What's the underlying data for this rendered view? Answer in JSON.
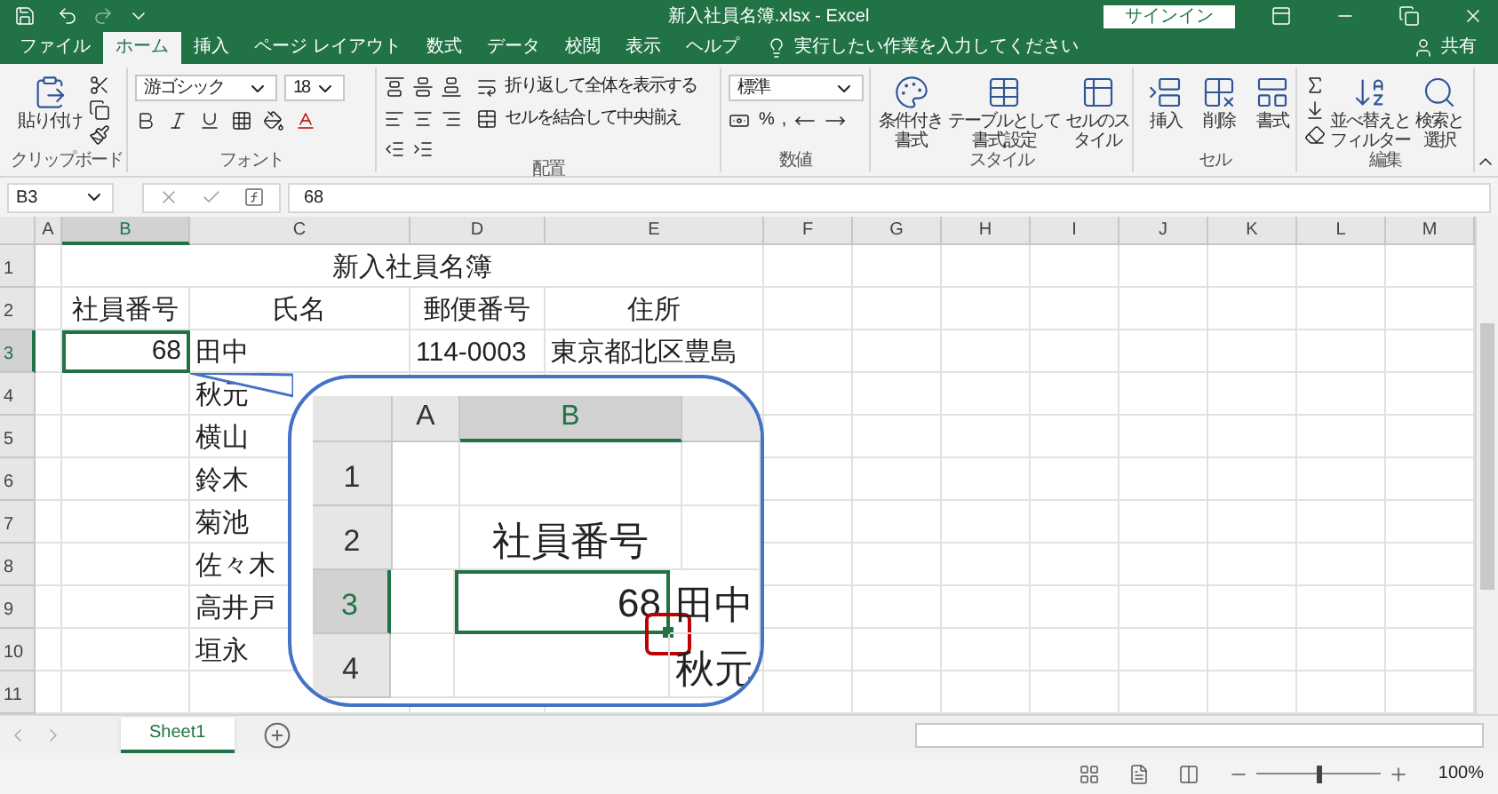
{
  "title_bar": {
    "title": "新入社員名簿.xlsx - Excel",
    "sign_in": "サインイン"
  },
  "tabs": [
    {
      "label": "ファイル",
      "selected": false
    },
    {
      "label": "ホーム",
      "selected": true
    },
    {
      "label": "挿入",
      "selected": false
    },
    {
      "label": "ページ レイアウト",
      "selected": false
    },
    {
      "label": "数式",
      "selected": false
    },
    {
      "label": "データ",
      "selected": false
    },
    {
      "label": "校閲",
      "selected": false
    },
    {
      "label": "表示",
      "selected": false
    },
    {
      "label": "ヘルプ",
      "selected": false
    }
  ],
  "tell_me": "実行したい作業を入力してください",
  "share": "共有",
  "ribbon": {
    "clipboard": {
      "label": "クリップボード",
      "paste": "貼り付け"
    },
    "font": {
      "label": "フォント",
      "font_name": "游ゴシック",
      "font_size": "18"
    },
    "alignment": {
      "label": "配置",
      "wrap_text": "折り返して全体を表示する",
      "merge_center": "セルを結合して中央揃え"
    },
    "number": {
      "label": "数値",
      "format": "標準",
      "percent": "%",
      "comma": ","
    },
    "styles": {
      "label": "スタイル",
      "buttons": [
        "条件付き書式",
        "テーブルとして書式設定",
        "セルのスタイル"
      ]
    },
    "cells": {
      "label": "セル",
      "buttons": [
        "挿入",
        "削除",
        "書式"
      ]
    },
    "editing": {
      "label": "編集",
      "buttons": [
        "並べ替えとフィルター",
        "検索と選択"
      ]
    }
  },
  "formula_bar": {
    "name_box": "B3",
    "formula": "68"
  },
  "sheet": {
    "columns": [
      {
        "label": "A",
        "selected": false
      },
      {
        "label": "B",
        "selected": true
      },
      {
        "label": "C",
        "selected": false
      },
      {
        "label": "D",
        "selected": false
      },
      {
        "label": "E",
        "selected": false
      },
      {
        "label": "F",
        "selected": false
      },
      {
        "label": "G",
        "selected": false
      },
      {
        "label": "H",
        "selected": false
      },
      {
        "label": "I",
        "selected": false
      },
      {
        "label": "J",
        "selected": false
      },
      {
        "label": "K",
        "selected": false
      },
      {
        "label": "L",
        "selected": false
      },
      {
        "label": "M",
        "selected": false
      }
    ],
    "rows": [
      {
        "header": "1",
        "selected": false,
        "kind": "title",
        "title": "新入社員名簿"
      },
      {
        "header": "2",
        "selected": false,
        "kind": "header",
        "b": {
          "text": "社員番号",
          "selected": false
        },
        "c": {
          "text": "氏名",
          "selected": false
        },
        "d": {
          "text": "郵便番号",
          "selected": false
        },
        "e": {
          "text": "住所",
          "selected": false
        }
      },
      {
        "header": "3",
        "selected": true,
        "kind": "data",
        "b": {
          "text": "68",
          "selected": true
        },
        "c": {
          "text": "田中",
          "selected": false
        },
        "d": {
          "text": "114-0003",
          "selected": false
        },
        "e": {
          "text": "東京都北区豊島",
          "selected": false
        }
      },
      {
        "header": "4",
        "selected": false,
        "kind": "data",
        "c": {
          "text": "秋元",
          "selected": false
        }
      },
      {
        "header": "5",
        "selected": false,
        "kind": "data",
        "c": {
          "text": "横山",
          "selected": false
        }
      },
      {
        "header": "6",
        "selected": false,
        "kind": "data",
        "c": {
          "text": "鈴木",
          "selected": false
        }
      },
      {
        "header": "7",
        "selected": false,
        "kind": "data",
        "c": {
          "text": "菊池",
          "selected": false
        }
      },
      {
        "header": "8",
        "selected": false,
        "kind": "data",
        "c": {
          "text": "佐々木",
          "selected": false
        }
      },
      {
        "header": "9",
        "selected": false,
        "kind": "data",
        "c": {
          "text": "高井戸",
          "selected": false
        }
      },
      {
        "header": "10",
        "selected": false,
        "kind": "data",
        "c": {
          "text": "垣永",
          "selected": false
        }
      },
      {
        "header": "11",
        "selected": false,
        "kind": "data"
      }
    ]
  },
  "callout": {
    "fill_handle_highlighted": true,
    "columns": [
      {
        "label": "A",
        "selected": false
      },
      {
        "label": "B",
        "selected": true
      }
    ],
    "rows": [
      {
        "header": "1",
        "selected": false
      },
      {
        "header": "2",
        "selected": false,
        "b": {
          "text": "社員番号",
          "selected": false
        }
      },
      {
        "header": "3",
        "selected": true,
        "b": {
          "text": "68",
          "selected": true
        },
        "c": {
          "text": "田中",
          "selected": false
        }
      },
      {
        "header": "4",
        "selected": false,
        "c": {
          "text": "秋元",
          "selected": false
        }
      }
    ]
  },
  "sheet_tabs": [
    {
      "label": "Sheet1",
      "selected": true
    }
  ],
  "status_bar": {
    "zoom": "100%",
    "zoom_slider": {
      "level": 0.5
    }
  }
}
